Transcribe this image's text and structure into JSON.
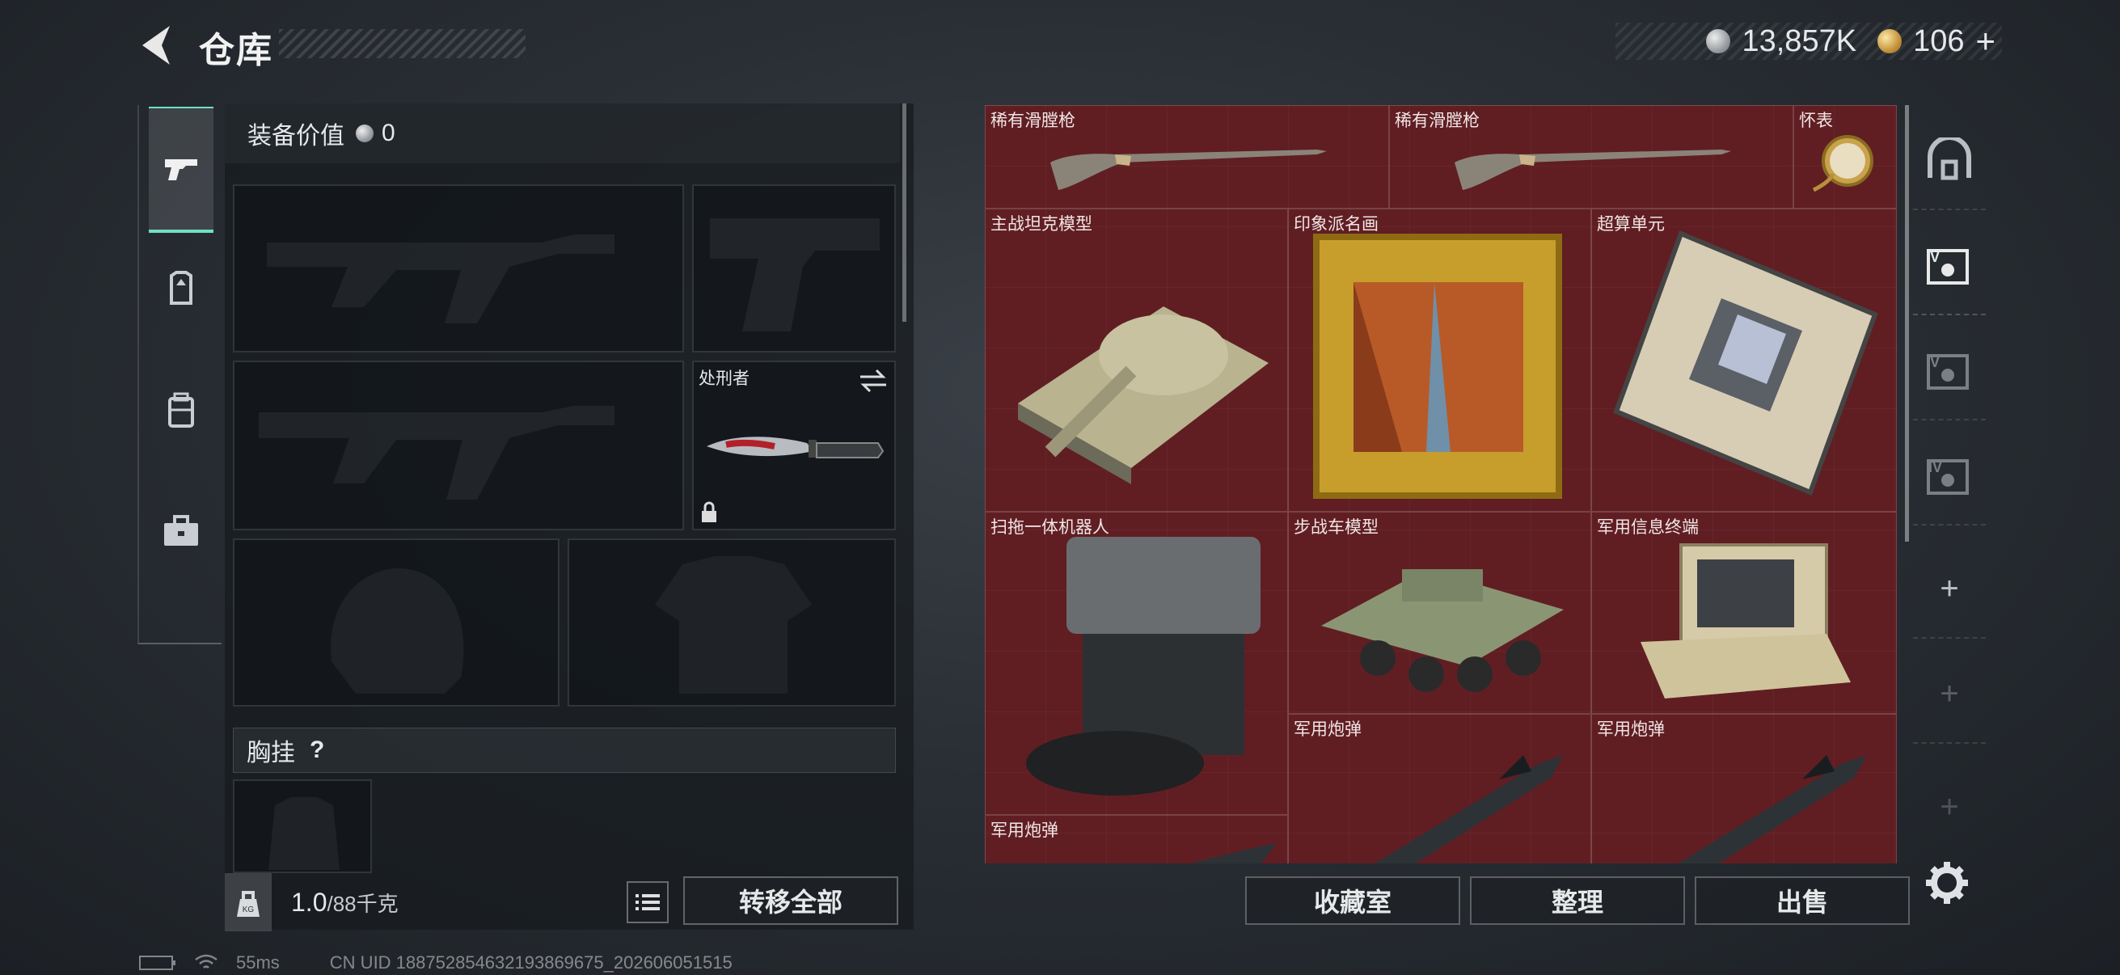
{
  "header": {
    "title": "仓库"
  },
  "currency": {
    "silver": "13,857K",
    "gold": "106",
    "plus": "+"
  },
  "equipment": {
    "value_label": "装备价值",
    "value": "0",
    "melee_label": "处刑者",
    "chest_label": "胸挂",
    "chest_help": "?"
  },
  "weight": {
    "current": "1.0",
    "max": "/88千克",
    "icon_label": "KG"
  },
  "buttons": {
    "transfer_all": "转移全部",
    "collection": "收藏室",
    "organize": "整理",
    "sell": "出售"
  },
  "storage": {
    "items": [
      {
        "label": "稀有滑膛枪"
      },
      {
        "label": "稀有滑膛枪"
      },
      {
        "label": "怀表"
      },
      {
        "label": "主战坦克模型"
      },
      {
        "label": "印象派名画"
      },
      {
        "label": "超算单元"
      },
      {
        "label": "扫拖一体机器人"
      },
      {
        "label": "步战车模型"
      },
      {
        "label": "军用信息终端"
      },
      {
        "label": "军用炮弹"
      },
      {
        "label": "军用炮弹"
      },
      {
        "label": "军用炮弹"
      }
    ]
  },
  "side_tabs": {
    "level5": "V",
    "level4": "IV"
  },
  "status": {
    "ping": "55ms",
    "uid": "CN UID 188752854632193869675_202606051515"
  }
}
